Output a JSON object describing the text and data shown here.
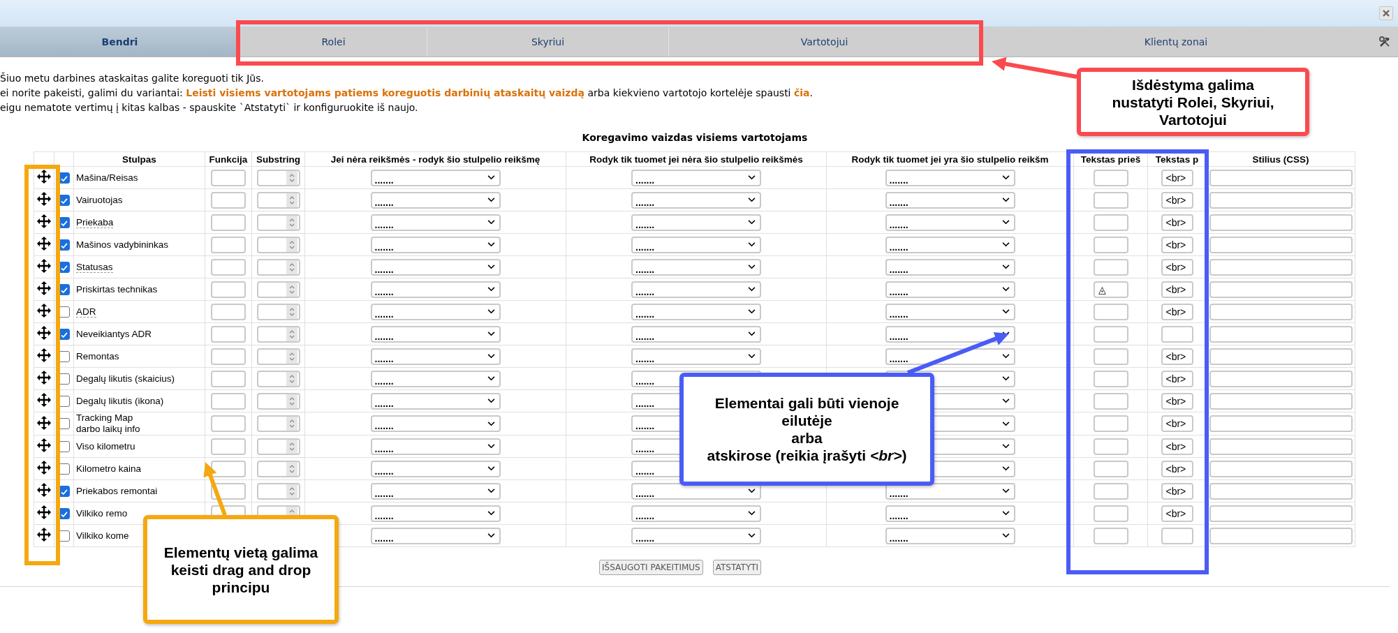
{
  "tabs": [
    {
      "label": "Bendri",
      "selected": true
    },
    {
      "label": "Rolei",
      "selected": false
    },
    {
      "label": "Skyriui",
      "selected": false
    },
    {
      "label": "Vartotojui",
      "selected": false
    },
    {
      "label": "Klientų zonai",
      "selected": false
    }
  ],
  "notice": [
    [
      {
        "kind": "text",
        "text": "Šiuo metu darbines ataskaitas galite koreguoti tik Jūs."
      }
    ],
    [
      {
        "kind": "text",
        "text": "ei norite pakeisti, galimi du variantai: "
      },
      {
        "kind": "link",
        "text": "Leisti visiems vartotojams patiems koreguotis darbinių ataskaitų vaizdą"
      },
      {
        "kind": "text",
        "text": " arba kiekvieno vartotojo kortelėje spausti "
      },
      {
        "kind": "link",
        "text": "čia"
      },
      {
        "kind": "text",
        "text": "."
      }
    ],
    [
      {
        "kind": "text",
        "text": "eigu nematote vertimų į kitas kalbas - spauskite `Atstatyti` ir konfiguruokite iš naujo."
      }
    ]
  ],
  "table": {
    "title": "Koregavimo vaizdas visiems vartotojams",
    "columns": [
      "Stulpas",
      "Funkcija",
      "Substring",
      "Jei nėra reikšmės - rodyk šio stulpelio reikšmę",
      "Rodyk tik tuomet jei nėra šio stulpelio reikšmės",
      "Rodyk tik tuomet jei yra šio stulpelio reikšm",
      "Tekstas prieš",
      "Tekstas p",
      "Stilius (CSS)"
    ],
    "rows": [
      {
        "name": "Mašina/Reisas",
        "underlined": false,
        "checked": true,
        "select_1": ".......",
        "select_2": ".......",
        "select_3": ".......",
        "text_after": "<br>"
      },
      {
        "name": "Vairuotojas",
        "underlined": false,
        "checked": true,
        "select_1": ".......",
        "select_2": ".......",
        "select_3": ".......",
        "text_after": "<br>"
      },
      {
        "name": "Priekaba",
        "underlined": true,
        "checked": true,
        "select_1": ".......",
        "select_2": ".......",
        "select_3": ".......",
        "text_after": "<br>"
      },
      {
        "name": "Mašinos vadybininkas",
        "underlined": false,
        "checked": true,
        "select_1": ".......",
        "select_2": ".......",
        "select_3": ".......",
        "text_after": "<br>"
      },
      {
        "name": "Statusas",
        "underlined": true,
        "checked": true,
        "select_1": ".......",
        "select_2": ".......",
        "select_3": ".......",
        "text_after": "<br>"
      },
      {
        "name": "Priskirtas technikas",
        "underlined": false,
        "checked": true,
        "select_1": ".......",
        "select_2": ".......",
        "select_3": ".......",
        "text_before": "◬",
        "text_after": "<br>"
      },
      {
        "name": "ADR",
        "underlined": true,
        "checked": false,
        "select_1": ".......",
        "select_2": ".......",
        "select_3": ".......",
        "text_after": "<br>"
      },
      {
        "name": "Neveikiantys ADR",
        "underlined": false,
        "checked": true,
        "select_1": ".......",
        "select_2": ".......",
        "select_3": "......."
      },
      {
        "name": "Remontas",
        "underlined": false,
        "checked": false,
        "select_1": ".......",
        "select_2": ".......",
        "select_3": ".......",
        "text_after": "<br>"
      },
      {
        "name": "Degalų likutis (skaicius)",
        "underlined": false,
        "checked": false,
        "select_1": ".......",
        "select_2": ".......",
        "text_after": "<br>"
      },
      {
        "name": "Degalų likutis (ikona)",
        "underlined": false,
        "checked": false,
        "select_1": ".......",
        "select_2": ".......",
        "text_after": "<br>"
      },
      {
        "name": "Tracking Map\ndarbo laikų info",
        "underlined": false,
        "checked": false,
        "select_1": ".......",
        "select_2": ".......",
        "text_after": "<br>"
      },
      {
        "name": "Viso kilometru",
        "underlined": false,
        "checked": false,
        "select_1": ".......",
        "select_2": ".......",
        "text_after": "<br>"
      },
      {
        "name": "Kilometro kaina",
        "underlined": false,
        "checked": false,
        "select_1": ".......",
        "select_2": ".......",
        "text_after": "<br>"
      },
      {
        "name": "Priekabos remontai",
        "underlined": false,
        "checked": true,
        "select_1": ".......",
        "select_2": ".......",
        "select_3": ".......",
        "text_after": "<br>"
      },
      {
        "name": "Vilkiko remo",
        "underlined": false,
        "checked": true,
        "select_1": ".......",
        "select_2": ".......",
        "select_3": ".......",
        "text_after": "<br>"
      },
      {
        "name": "Vilkiko kome",
        "underlined": false,
        "checked": false,
        "select_1": ".......",
        "select_2": ".......",
        "select_3": "......."
      }
    ]
  },
  "buttons": [
    "IŠSAUGOTI PAKEITIMUS",
    "ATSTATYTI"
  ],
  "annotations": [
    {
      "color": "#fb4a4e",
      "text": "Išdėstyma galima\nnustatyti Rolei, Skyriui,\nVartotojui"
    },
    {
      "color": "#4a5cf5",
      "text": "Elementai gali būti vienoje\neilutėje\narba\natskirose (reikia įrašyti *<br>*)"
    },
    {
      "color": "#f5a80f",
      "text": "Elementų vietą galima\nkeisti drag and drop\nprincipu"
    }
  ]
}
